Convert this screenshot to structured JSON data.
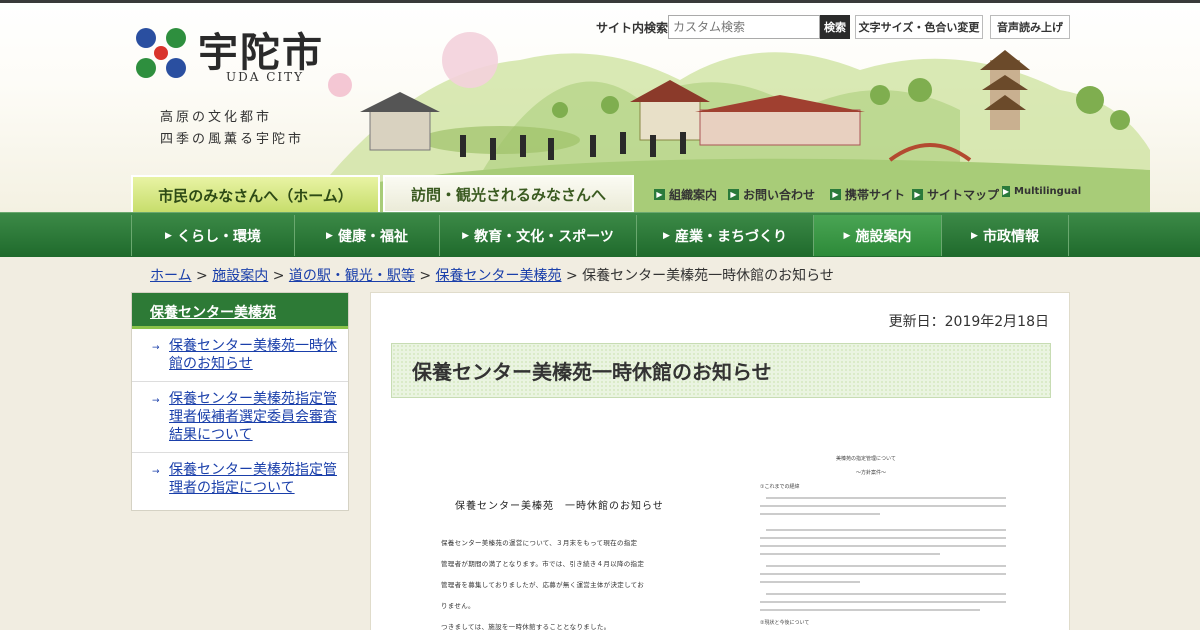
{
  "header": {
    "city_name": "宇陀市",
    "city_name_en": "UDA CITY",
    "tagline_1": "高原の文化都市",
    "tagline_2": "四季の風薫る宇陀市",
    "search_label": "サイト内検索",
    "search_placeholder": "カスタム検索",
    "search_button": "検索",
    "font_color_button": "文字サイズ・色合い変更",
    "read_aloud_button": "音声読み上げ"
  },
  "audience_tabs": {
    "residents": "市民のみなさんへ（ホーム）",
    "visitors": "訪問・観光されるみなさんへ"
  },
  "utility_links": [
    "組織案内",
    "お問い合わせ",
    "携帯サイト",
    "サイトマップ",
    "Multilingual"
  ],
  "global_nav": [
    "くらし・環境",
    "健康・福祉",
    "教育・文化・スポーツ",
    "産業・まちづくり",
    "施設案内",
    "市政情報"
  ],
  "active_nav": "施設案内",
  "breadcrumb": {
    "items": [
      "ホーム",
      "施設案内",
      "道の駅・観光・駅等",
      "保養センター美榛苑"
    ],
    "current": "保養センター美榛苑一時休館のお知らせ",
    "separator": ">"
  },
  "sidebar": {
    "title": "保養センター美榛苑",
    "items": [
      "保養センター美榛苑一時休館のお知らせ",
      "保養センター美榛苑指定管理者候補者選定委員会審査結果について",
      "保養センター美榛苑指定管理者の指定について"
    ]
  },
  "main": {
    "updated": "更新日：2019年2月18日",
    "title": "保養センター美榛苑一時休館のお知らせ"
  },
  "document": {
    "left_title": "保養センター美榛苑　一時休館のお知らせ",
    "left_lines": [
      "保養センター美榛苑の運営について、３月末をもって現在の指定",
      "管理者が期間の満了となります。市では、引き続き４月以降の指定",
      "管理者を募集しておりましたが、応募が無く運営主体が決定してお",
      "りません。",
      "つきましては、施設を一時休館することとなりました。"
    ],
    "right_title": "美榛苑の指定管理について",
    "right_subtitle": "～方針案件～",
    "right_section_1": "①これまでの経緯",
    "right_section_2": "②現状と今後について"
  },
  "colors": {
    "nav_green": "#1f6a2c",
    "link_blue": "#1a3faa",
    "tab_yellow_green": "#c6dd6a"
  }
}
